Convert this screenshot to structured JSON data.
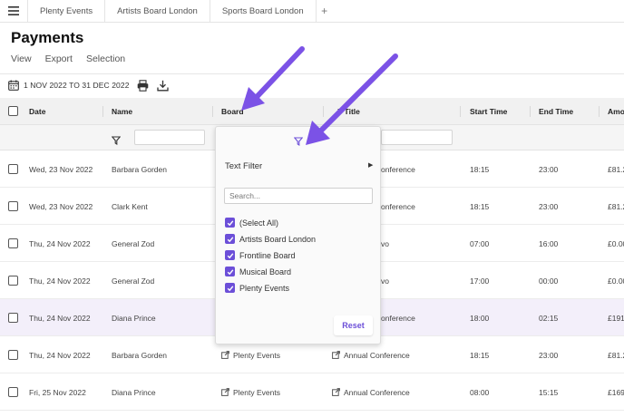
{
  "app": {
    "tabs": [
      {
        "label": "Plenty Events"
      },
      {
        "label": "Artists Board London"
      },
      {
        "label": "Sports Board London"
      }
    ],
    "add_tab_label": "+"
  },
  "page": {
    "title": "Payments",
    "menu": [
      "View",
      "Export",
      "Selection"
    ],
    "date_range": "1 NOV 2022 TO 31 DEC 2022"
  },
  "grid": {
    "columns": [
      "Date",
      "Name",
      "Board",
      "Job Title",
      "Start Time",
      "End Time",
      "Amount"
    ],
    "visible_header_fragments": {
      "job_title": "b Title",
      "amount": "Amo"
    },
    "rows": [
      {
        "date": "Wed, 23 Nov 2022",
        "name": "Barbara Gorden",
        "board": "",
        "job": "onference",
        "start": "18:15",
        "end": "23:00",
        "amount": "£81.2",
        "highlight": false
      },
      {
        "date": "Wed, 23 Nov 2022",
        "name": "Clark Kent",
        "board": "",
        "job": "onference",
        "start": "18:15",
        "end": "23:00",
        "amount": "£81.2",
        "highlight": false
      },
      {
        "date": "Thu, 24 Nov 2022",
        "name": "General Zod",
        "board": "",
        "job": "vo",
        "start": "07:00",
        "end": "16:00",
        "amount": "£0.00",
        "highlight": false
      },
      {
        "date": "Thu, 24 Nov 2022",
        "name": "General Zod",
        "board": "",
        "job": "vo",
        "start": "17:00",
        "end": "00:00",
        "amount": "£0.00",
        "highlight": false
      },
      {
        "date": "Thu, 24 Nov 2022",
        "name": "Diana Prince",
        "board": "",
        "job": "onference",
        "start": "18:00",
        "end": "02:15",
        "amount": "£191",
        "highlight": true
      },
      {
        "date": "Thu, 24 Nov 2022",
        "name": "Barbara Gorden",
        "board": "Plenty Events",
        "job": "Annual Conference",
        "start": "18:15",
        "end": "23:00",
        "amount": "£81.2",
        "highlight": false
      },
      {
        "date": "Fri, 25 Nov 2022",
        "name": "Diana Prince",
        "board": "Plenty Events",
        "job": "Annual Conference",
        "start": "08:00",
        "end": "15:15",
        "amount": "£169",
        "highlight": false
      }
    ]
  },
  "filter_popup": {
    "text_filter_label": "Text Filter",
    "search_placeholder": "Search...",
    "options": [
      "(Select All)",
      "Artists Board London",
      "Frontline Board",
      "Musical Board",
      "Plenty Events"
    ],
    "reset_label": "Reset"
  },
  "colors": {
    "accent": "#6c4fd8",
    "annotation_arrow": "#7b52e6",
    "highlight_row": "#f3effa"
  },
  "icons": [
    "hamburger-icon",
    "calendar-icon",
    "print-icon",
    "download-icon",
    "filter-icon",
    "external-link-icon",
    "chevron-right-icon",
    "checkmark-icon"
  ]
}
